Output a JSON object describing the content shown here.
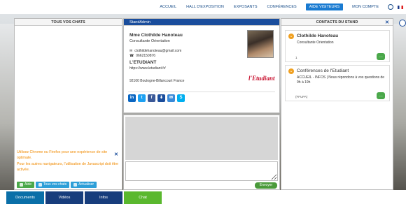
{
  "nav": {
    "items": [
      "ACCUEIL",
      "HALL D'EXPOSITION",
      "EXPOSANTS",
      "CONFÉRENCES"
    ],
    "active": "AIDE VISITEURS",
    "account": "MON COMPTE"
  },
  "chats": {
    "title": "TOUS VOS CHATS",
    "warning_line1": "Utilisez Chrome ou Firefox pour une expérience de site optimale.",
    "warning_line2": "Pour les autres navigateurs, l'utilisation de Javascript doit être activée.",
    "close": "✕",
    "buttons": [
      "Aide",
      "Tous vos chats",
      "Actualiser"
    ]
  },
  "stand": {
    "header": "StandAdmin",
    "name": "Mme Clothilde Hanoteau",
    "role": "Consultante Orientation",
    "email": "clothildehanoteau@gmail.com",
    "phone": "0662150876",
    "org": "L'ETUDIANT",
    "url": "https://www.letudiant.fr/",
    "address": "92100 Boulogne-Billancourt France",
    "logo": "l'Etudiant",
    "social": [
      "in",
      "t",
      "f",
      "⬇",
      "✉",
      "S"
    ]
  },
  "chat": {
    "send": "Envoyer"
  },
  "contacts": {
    "title": "CONTACTS DU STAND",
    "close": "✕",
    "cards": [
      {
        "name": "Clothilde Hanoteau",
        "sub": "Consultante Orientation",
        "foot": "1"
      },
      {
        "name": "Conférences de l'Etudiant",
        "sub": "ACCUEIL - INFOS | Nous répondons à vos questions de 9h à 19h",
        "foot": "(FFUPA)"
      }
    ]
  },
  "tabs": [
    "Documents",
    "Vidéos",
    "Infos",
    "Chat"
  ],
  "colors": {
    "nav_blue": "#1b4f8a",
    "accent": "#1a7bd1",
    "warning": "#f08a00",
    "chat_green": "#5ab82e",
    "stand_header": "#1a4d9c",
    "brand_red": "#c8102e"
  }
}
